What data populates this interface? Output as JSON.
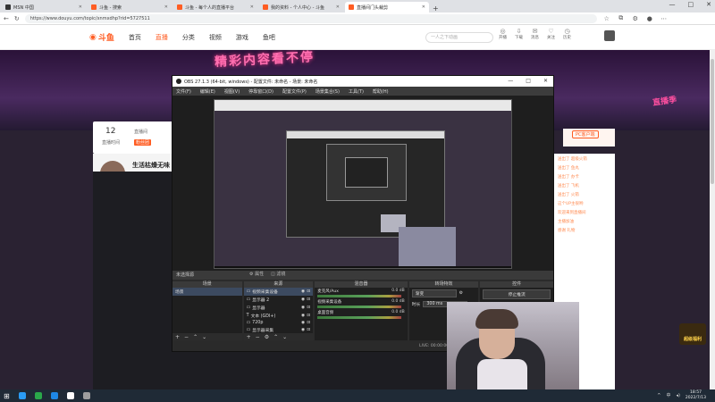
{
  "browser": {
    "tabs": [
      {
        "title": "MSN 中国",
        "color": "#333333"
      },
      {
        "title": "斗鱼 - 搜索",
        "color": "#ff5d23"
      },
      {
        "title": "斗鱼 - 每个人的直播平台",
        "color": "#ff5d23"
      },
      {
        "title": "我的资料 - 个人中心 - 斗鱼",
        "color": "#ff5d23"
      },
      {
        "title": "直播间门头裁剪",
        "color": "#ff5d23"
      }
    ],
    "new_tab": "+",
    "url": "https://www.douyu.com/topic/xnmxdhp?rid=5727511",
    "window_controls": [
      "—",
      "□",
      "✕"
    ]
  },
  "site": {
    "logo": "斗鱼",
    "nav": [
      "首页",
      "直播",
      "分类",
      "视频",
      "游戏",
      "鱼吧"
    ],
    "search_placeholder": "一人之下动画",
    "header_icons": [
      "开播",
      "下载",
      "消息",
      "关注",
      "历史"
    ],
    "banner_text": "精彩内容看不停",
    "right_badge": "直播季",
    "stat_value": "12",
    "stat_label": "直播时间",
    "stat_right": "直播间",
    "stat_right_tag": "粉丝团",
    "streamer_name": "生活枯燥无味",
    "follow": "关注",
    "pc_button": "PC客户端",
    "chat_lines": [
      "送出了 超级火箭",
      "送出了 鱼丸",
      "送出了 办卡",
      "送出了 飞机",
      "送出了 火箭",
      "这个UP主很哟",
      "欢迎来到直播间",
      "主播加油",
      "感谢 礼物"
    ],
    "side_badge": "超级福利"
  },
  "obs": {
    "title": "OBS 27.1.3 (64-bit, windows) - 配置文件: 未命名 - 场景: 未命名",
    "menu": [
      "文件(F)",
      "编辑(E)",
      "视图(V)",
      "停靠窗口(D)",
      "配置文件(P)",
      "场景集合(S)",
      "工具(T)",
      "帮助(H)"
    ],
    "scene_label": "未选择源",
    "ctrl_tabs": [
      "属性",
      "滤镜"
    ],
    "docks": {
      "scenes": {
        "header": "场景",
        "items": [
          "场景"
        ]
      },
      "sources": {
        "header": "来源",
        "items": [
          "视频采集设备",
          "显示器 2",
          "显示器",
          "文本 (GDI+)",
          "720p",
          "显示器采集"
        ]
      },
      "mixer": {
        "header": "混音器",
        "rows": [
          {
            "name": "麦克风/Aux",
            "db": "0.0 dB"
          },
          {
            "name": "视频采集设备",
            "db": "0.0 dB"
          },
          {
            "name": "桌面音频",
            "db": "0.0 dB"
          }
        ]
      },
      "transitions": {
        "header": "转场特效",
        "type": "渐变",
        "duration_label": "时长",
        "duration": "300 ms"
      },
      "controls": {
        "header": "控件",
        "buttons": [
          "停止推流",
          "开始录制",
          "启动虚拟摄像机",
          "工作室模式",
          "设置",
          "退出"
        ]
      }
    },
    "status": [
      "LIVE: 00:00:00",
      "REC: 00:00:00",
      "CPU: 4.1%, 30.00 fps",
      "kb/s: 0"
    ]
  },
  "taskbar": {
    "apps": [
      "#2a9df4",
      "#2aa84a",
      "#1e88e5",
      "#ffffff",
      "#9e9e9e"
    ],
    "tray": [
      "^",
      "中",
      "◂)"
    ],
    "time": "18:57",
    "date": "2022/7/13"
  }
}
